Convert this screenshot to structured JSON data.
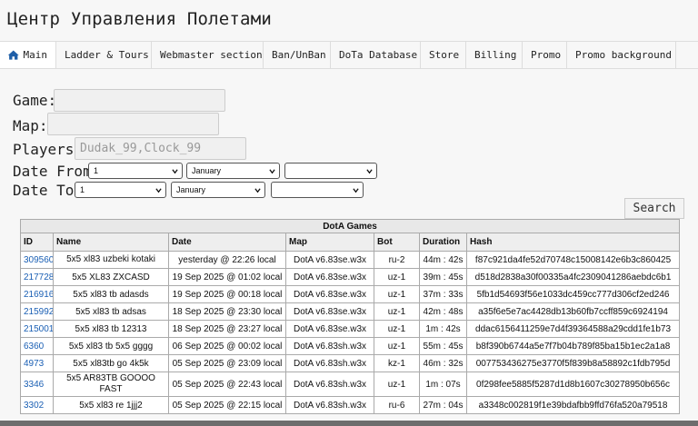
{
  "page_title": "Центр Управления Полетами",
  "nav": [
    {
      "label": "Main",
      "icon": "home-icon"
    },
    {
      "label": "Ladder & Tours"
    },
    {
      "label": "Webmaster section"
    },
    {
      "label": "Ban/UnBan"
    },
    {
      "label": "DoTa Database"
    },
    {
      "label": "Store"
    },
    {
      "label": "Billing"
    },
    {
      "label": "Promo"
    },
    {
      "label": "Promo background"
    }
  ],
  "form": {
    "game_label": "Game:",
    "game_value": "",
    "map_label": "Map:",
    "map_value": "",
    "players_label": "Players:",
    "players_placeholder": "Dudak_99,Clock_99",
    "date_from_label": "Date From:",
    "date_to_label": "Date To:",
    "date_from": {
      "day": "1",
      "month": "January",
      "year": ""
    },
    "date_to": {
      "day": "1",
      "month": "January",
      "year": ""
    },
    "search_label": "Search"
  },
  "table": {
    "caption": "DotA Games",
    "columns": [
      "ID",
      "Name",
      "Date",
      "Map",
      "Bot",
      "Duration",
      "Hash"
    ],
    "rows": [
      {
        "id": "309560",
        "name": "5x5 xl83 uzbeki kotaki",
        "date": "yesterday @ 22:26 local",
        "map": "DotA v6.83se.w3x",
        "bot": "ru-2",
        "duration": "44m : 42s",
        "hash": "f87c921da4fe52d70748c15008142e6b3c860425"
      },
      {
        "id": "217728",
        "name": "5x5 XL83 ZXCASD",
        "date": "19 Sep 2025 @ 01:02 local",
        "map": "DotA v6.83se.w3x",
        "bot": "uz-1",
        "duration": "39m : 45s",
        "hash": "d518d2838a30f00335a4fc2309041286aebdc6b1"
      },
      {
        "id": "216916",
        "name": "5x5 xl83 tb adasds",
        "date": "19 Sep 2025 @ 00:18 local",
        "map": "DotA v6.83se.w3x",
        "bot": "uz-1",
        "duration": "37m : 33s",
        "hash": "5fb1d54693f56e1033dc459cc777d306cf2ed246"
      },
      {
        "id": "215992",
        "name": "5x5 xl83 tb adsas",
        "date": "18 Sep 2025 @ 23:30 local",
        "map": "DotA v6.83se.w3x",
        "bot": "uz-1",
        "duration": "42m : 48s",
        "hash": "a35f6e5e7ac4428db13b60fb7ccff859c6924194"
      },
      {
        "id": "215001",
        "name": "5x5 xl83 tb 12313",
        "date": "18 Sep 2025 @ 23:27 local",
        "map": "DotA v6.83se.w3x",
        "bot": "uz-1",
        "duration": "1m : 42s",
        "hash": "ddac6156411259e7d4f39364588a29cdd1fe1b73"
      },
      {
        "id": "6360",
        "name": "5x5 xl83 tb 5x5 gggg",
        "date": "06 Sep 2025 @ 00:02 local",
        "map": "DotA v6.83sh.w3x",
        "bot": "uz-1",
        "duration": "55m : 45s",
        "hash": "b8f390b6744a5e7f7b04b789f85ba15b1ec2a1a8"
      },
      {
        "id": "4973",
        "name": "5x5 xl83tb go 4k5k",
        "date": "05 Sep 2025 @ 23:09 local",
        "map": "DotA v6.83sh.w3x",
        "bot": "kz-1",
        "duration": "46m : 32s",
        "hash": "007753436275e3770f5f839b8a58892c1fdb795d"
      },
      {
        "id": "3346",
        "name": "5x5 AR83TB GOOOO FAST",
        "date": "05 Sep 2025 @ 22:43 local",
        "map": "DotA v6.83sh.w3x",
        "bot": "uz-1",
        "duration": "1m : 07s",
        "hash": "0f298fee5885f5287d1d8b1607c30278950b656c"
      },
      {
        "id": "3302",
        "name": "5x5 xl83 re 1jjj2",
        "date": "05 Sep 2025 @ 22:15 local",
        "map": "DotA v6.83sh.w3x",
        "bot": "ru-6",
        "duration": "27m : 04s",
        "hash": "a3348c002819f1e39bdafbb9ffd76fa520a79518"
      }
    ]
  },
  "colors": {
    "link": "#1a5fb4",
    "home_icon": "#1f5fa8"
  }
}
